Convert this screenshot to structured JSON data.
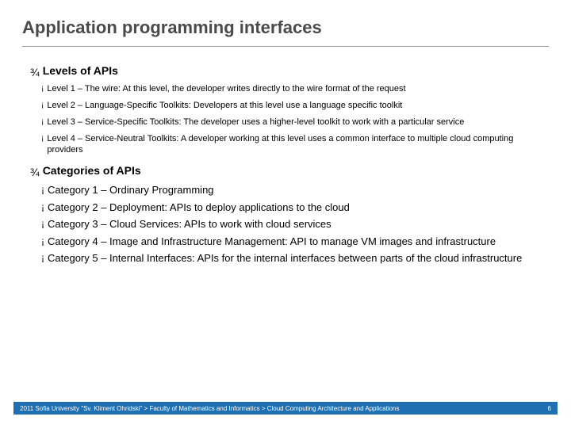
{
  "title": "Application programming interfaces",
  "sections": [
    {
      "heading": "Levels of APIs",
      "heading_bullet": "¾",
      "item_bullet": "¡",
      "size": "small",
      "items": [
        "Level 1 – The wire: At this level, the developer writes directly to the wire format of the request",
        "Level 2 – Language-Specific Toolkits: Developers at this level use a language specific toolkit",
        "Level 3 – Service-Specific Toolkits: The developer uses a higher-level toolkit to work with a particular service",
        "Level 4 – Service-Neutral Toolkits: A developer working at this level uses a common interface to multiple cloud computing providers"
      ]
    },
    {
      "heading": "Categories of APIs",
      "heading_bullet": "¾",
      "item_bullet": "¡",
      "size": "large",
      "items": [
        "Category 1 – Ordinary Programming",
        "Category 2 – Deployment: APIs to deploy applications to the cloud",
        "Category 3 – Cloud Services: APIs to work with cloud services",
        "Category 4 – Image and Infrastructure Management: API to manage VM images and infrastructure",
        "Category 5 – Internal Interfaces: APIs for the internal interfaces between parts of the cloud infrastructure"
      ]
    }
  ],
  "footer": {
    "left": "2011 Sofia University \"Sv. Kliment Ohridski\" > Faculty of Mathematics and Informatics > Cloud Computing Architecture and Applications",
    "page": "6"
  }
}
